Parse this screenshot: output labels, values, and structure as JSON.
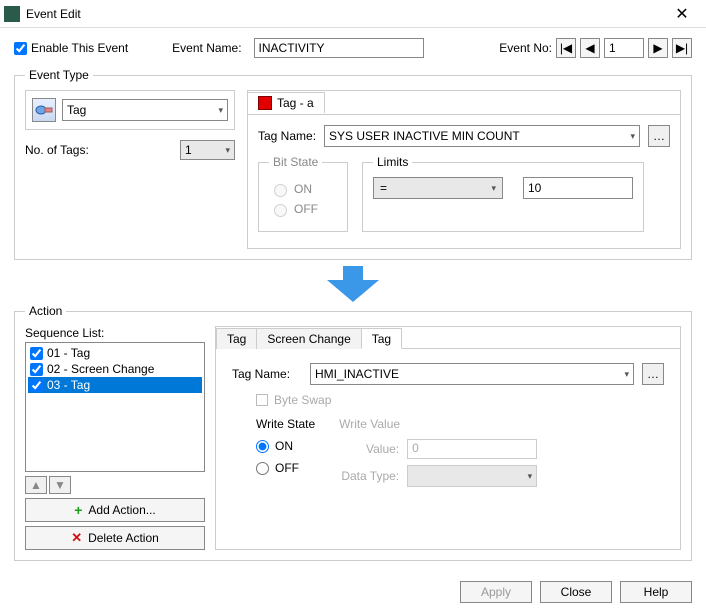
{
  "window": {
    "title": "Event Edit"
  },
  "header": {
    "enable_label": "Enable This Event",
    "enable_checked": true,
    "event_name_label": "Event Name:",
    "event_name_value": "INACTIVITY",
    "event_no_label": "Event No:",
    "event_no_value": "1"
  },
  "event_type": {
    "legend": "Event Type",
    "type_value": "Tag",
    "no_of_tags_label": "No. of Tags:",
    "no_of_tags_value": "1",
    "tab_label": "Tag - a",
    "tag_name_label": "Tag Name:",
    "tag_name_value": "SYS USER INACTIVE MIN COUNT",
    "bitstate": {
      "legend": "Bit State",
      "on": "ON",
      "off": "OFF"
    },
    "limits": {
      "legend": "Limits",
      "operator": "=",
      "value": "10"
    }
  },
  "action": {
    "legend": "Action",
    "seq_label": "Sequence List:",
    "sequence": [
      {
        "label": "01 - Tag",
        "checked": true,
        "selected": false
      },
      {
        "label": "02 - Screen Change",
        "checked": true,
        "selected": false
      },
      {
        "label": "03 - Tag",
        "checked": true,
        "selected": true
      }
    ],
    "add_label": "Add Action...",
    "delete_label": "Delete Action",
    "tabs": [
      "Tag",
      "Screen Change",
      "Tag"
    ],
    "active_tab": 2,
    "tag_panel": {
      "tag_name_label": "Tag Name:",
      "tag_name_value": "HMI_INACTIVE",
      "byte_swap_label": "Byte Swap",
      "write_state": {
        "title": "Write State",
        "on": "ON",
        "off": "OFF",
        "selected": "ON"
      },
      "write_value": {
        "title": "Write Value",
        "value_label": "Value:",
        "value": "0",
        "datatype_label": "Data Type:",
        "datatype": ""
      }
    }
  },
  "footer": {
    "apply": "Apply",
    "close": "Close",
    "help": "Help"
  }
}
